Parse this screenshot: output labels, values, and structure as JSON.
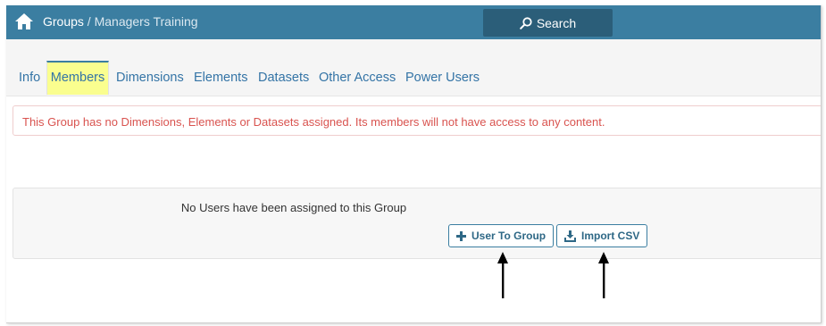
{
  "header": {
    "breadcrumb_root": "Groups",
    "breadcrumb_separator": " / ",
    "breadcrumb_current": "Managers Training",
    "search_label": "Search"
  },
  "tabs": [
    {
      "label": "Info",
      "active": false
    },
    {
      "label": "Members",
      "active": true
    },
    {
      "label": "Dimensions",
      "active": false
    },
    {
      "label": "Elements",
      "active": false
    },
    {
      "label": "Datasets",
      "active": false
    },
    {
      "label": "Other Access",
      "active": false
    },
    {
      "label": "Power Users",
      "active": false
    }
  ],
  "alert": {
    "text": "This Group has no Dimensions, Elements or Datasets assigned. Its members will not have access to any content.",
    "color": "#d9534f"
  },
  "members_panel": {
    "empty_message": "No Users have been assigned to this Group",
    "add_button_label": "User To Group",
    "import_button_label": "Import CSV"
  },
  "icons": {
    "home": "home-icon",
    "search": "search-icon",
    "add": "plus-icon",
    "import": "download-icon"
  },
  "colors": {
    "header_bg": "#3b7ea1",
    "search_bg": "#2b5e79",
    "active_tab_highlight": "#fafe8f",
    "link": "#3474a6"
  }
}
